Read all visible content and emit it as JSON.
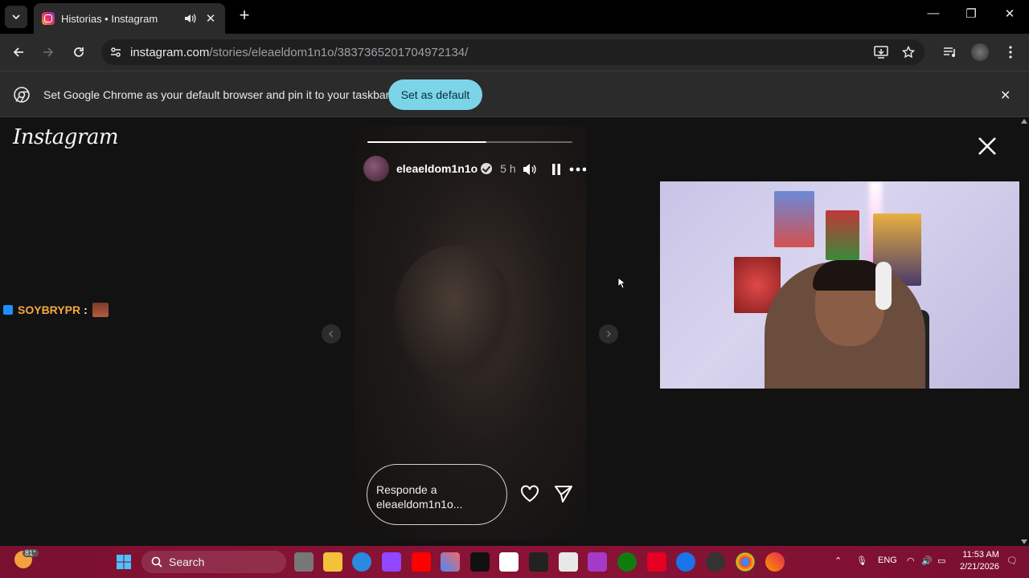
{
  "browser": {
    "tab": {
      "title": "Historias • Instagram"
    },
    "url": {
      "host": "instagram.com",
      "path": "/stories/eleaeldom1n1o/3837365201704972134/"
    },
    "infobar": {
      "message": "Set Google Chrome as your default browser and pin it to your taskbar",
      "button": "Set as default"
    }
  },
  "instagram": {
    "logo": "Instagram",
    "story": {
      "username": "eleaeldom1n1o",
      "time": "5 h",
      "progress": 0.58,
      "reply_placeholder": "Responde a eleaeldom1n1o..."
    }
  },
  "chat": {
    "user": "SOYBRYPR",
    "separator": ":"
  },
  "taskbar": {
    "search": "Search",
    "weather_temp": "81°",
    "language": "ENG",
    "time": "11:53 AM",
    "date": "2/21/2026"
  },
  "colors": {
    "accent_button": "#7cd4e8",
    "taskbar": "#8a1335",
    "chat_user": "#f5a742"
  }
}
